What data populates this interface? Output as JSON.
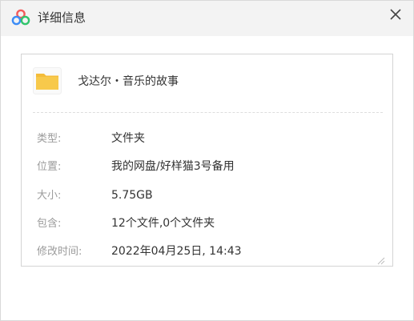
{
  "window": {
    "title": "详细信息",
    "app_icon": "baidu-netdisk-icon",
    "close_icon": "close-icon",
    "brand_colors": [
      "#3b8cf6",
      "#f35b5b",
      "#30c46c"
    ]
  },
  "file": {
    "icon": "folder-icon",
    "icon_color": "#f7c94b",
    "name": "戈达尔・音乐的故事"
  },
  "details": [
    {
      "label": "类型:",
      "value": "文件夹"
    },
    {
      "label": "位置:",
      "value": "我的网盘/好样猫3号备用"
    },
    {
      "label": "大小:",
      "value": "5.75GB"
    },
    {
      "label": "包含:",
      "value": "12个文件,0个文件夹"
    },
    {
      "label": "修改时间:",
      "value": "2022年04月25日, 14:43"
    }
  ]
}
